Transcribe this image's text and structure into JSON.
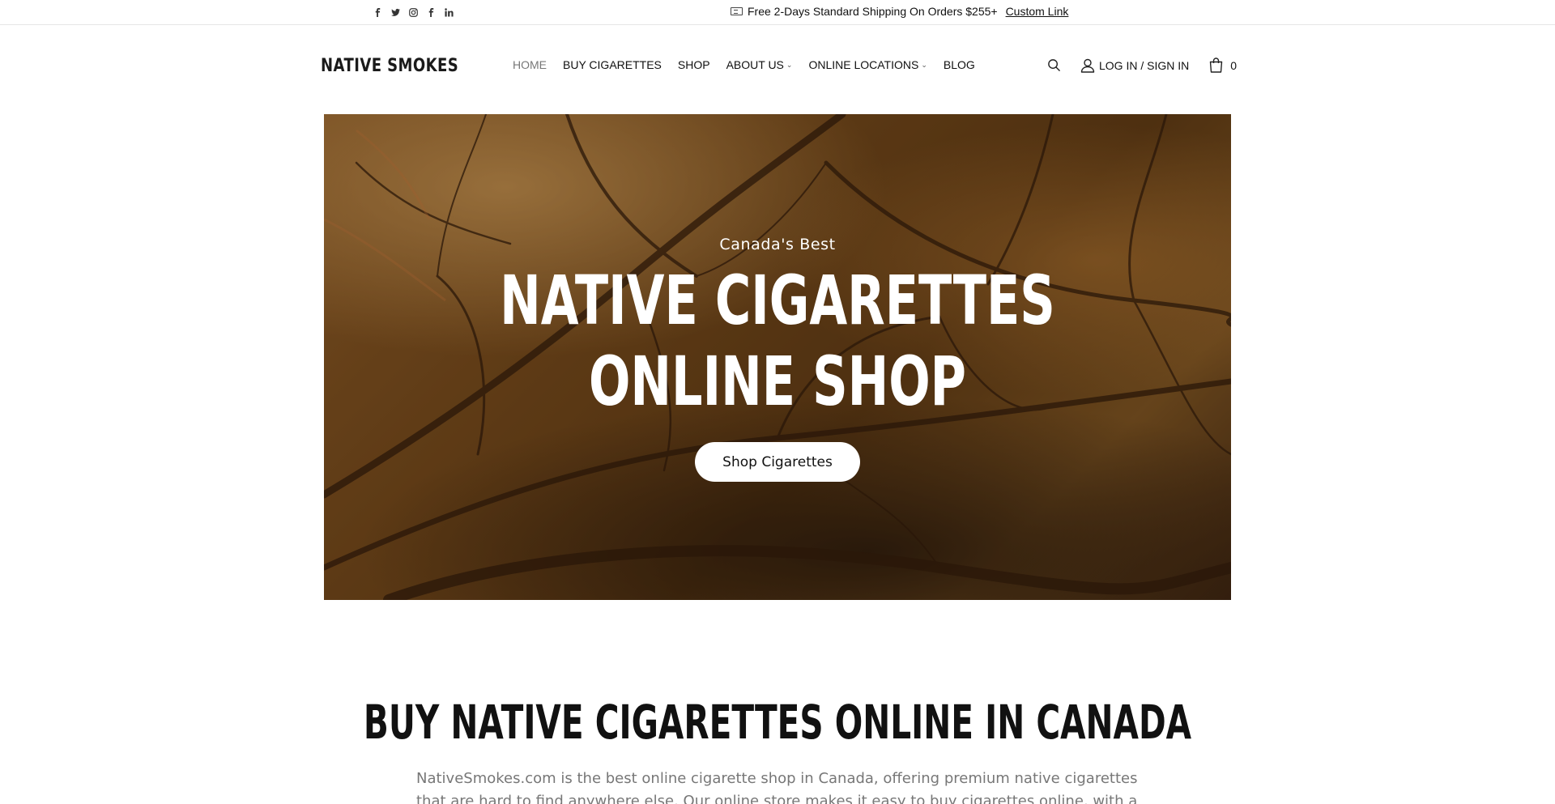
{
  "topbar": {
    "social": [
      {
        "name": "facebook-icon",
        "glyph": "f"
      },
      {
        "name": "twitter-icon",
        "glyph": "t"
      },
      {
        "name": "instagram-icon",
        "glyph": "o"
      },
      {
        "name": "facebook-alt-icon",
        "glyph": "f"
      },
      {
        "name": "linkedin-icon",
        "glyph": "in"
      }
    ],
    "announcement": "Free 2-Days Standard Shipping On Orders $255+",
    "link": "Custom Link"
  },
  "header": {
    "logo": "NATIVE SMOKES",
    "nav": [
      {
        "label": "HOME",
        "active": true,
        "dropdown": false
      },
      {
        "label": "BUY CIGARETTES",
        "active": false,
        "dropdown": false
      },
      {
        "label": "SHOP",
        "active": false,
        "dropdown": false
      },
      {
        "label": "ABOUT US",
        "active": false,
        "dropdown": true
      },
      {
        "label": "ONLINE LOCATIONS",
        "active": false,
        "dropdown": true
      },
      {
        "label": "BLOG",
        "active": false,
        "dropdown": false
      }
    ],
    "login": "LOG IN / SIGN IN",
    "cart_count": "0"
  },
  "hero": {
    "eyebrow": "Canada's Best",
    "title_line1": "NATIVE CIGARETTES",
    "title_line2": "ONLINE SHOP",
    "cta": "Shop Cigarettes"
  },
  "section": {
    "title": "BUY NATIVE CIGARETTES ONLINE IN CANADA",
    "body": "NativeSmokes.com is the best online cigarette shop in Canada, offering premium native cigarettes that are hard to find anywhere else. Our online store makes it easy to buy cigarettes online, with a wide selection of brands and"
  },
  "colors": {
    "hero_brown": "#6e4518",
    "text_dark": "#111111",
    "text_muted": "#777777"
  }
}
